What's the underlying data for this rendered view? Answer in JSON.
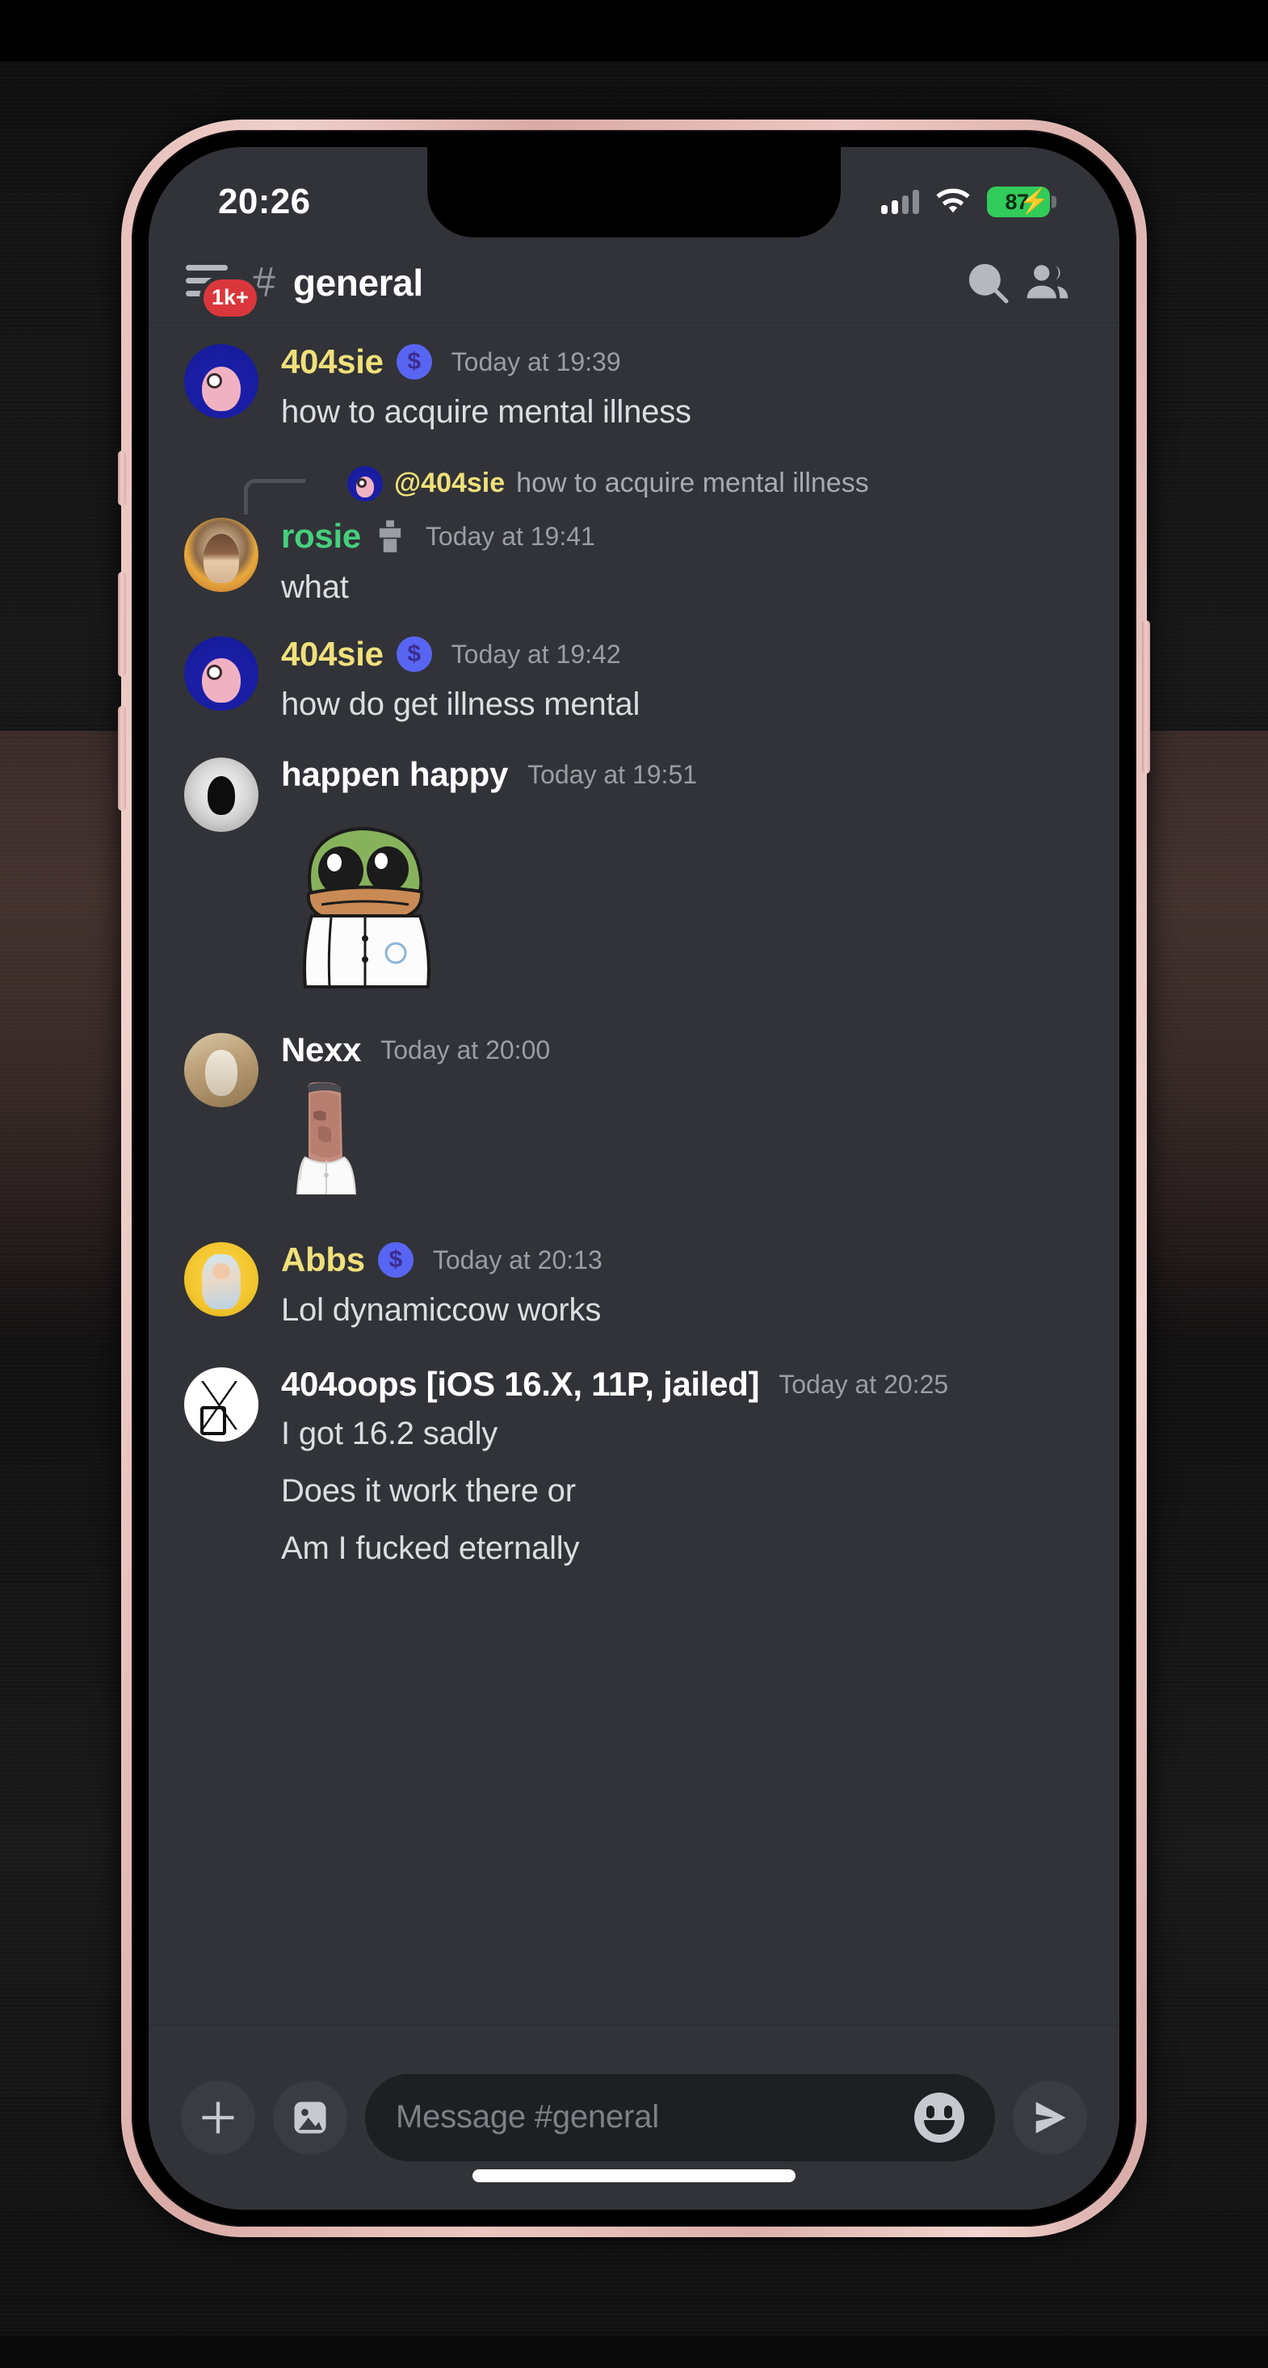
{
  "device": {
    "frame_color": "#e3b6b1",
    "screen_bg": "#313338"
  },
  "status_bar": {
    "time": "20:26",
    "signal_icon": "cellular-bars-icon",
    "signal_bars_filled": 2,
    "signal_bars_total": 4,
    "wifi_icon": "wifi-icon",
    "battery_percent": "87",
    "battery_charging": true,
    "battery_color": "#31cb5a"
  },
  "header": {
    "menu_icon": "hamburger-menu-icon",
    "unread_badge": "1k+",
    "badge_color": "#da373c",
    "hash_icon": "#",
    "channel_name": "general",
    "search_icon": "search-icon",
    "members_icon": "members-icon"
  },
  "messages": [
    {
      "id": "m1",
      "author": "404sie",
      "author_color": "yellow",
      "badge": "server-boost-badge",
      "timestamp": "Today at 19:39",
      "avatar": "slowpoke-avatar",
      "lines": [
        "how to acquire mental illness"
      ]
    },
    {
      "id": "m2",
      "type": "reply",
      "reply_to_author": "@404sie",
      "reply_to_text": "how to acquire mental illness",
      "reply_avatar": "slowpoke-avatar",
      "author": "rosie",
      "author_color": "green",
      "badge": "bot-tag-badge",
      "timestamp": "Today at 19:41",
      "avatar": "rosie-avatar",
      "lines": [
        "what"
      ]
    },
    {
      "id": "m3",
      "author": "404sie",
      "author_color": "yellow",
      "badge": "server-boost-badge",
      "timestamp": "Today at 19:42",
      "avatar": "slowpoke-avatar",
      "lines": [
        "how do get illness mental"
      ]
    },
    {
      "id": "m4",
      "author": "happen happy",
      "author_color": "white",
      "badge": null,
      "timestamp": "Today at 19:51",
      "avatar": "dark-blob-avatar",
      "lines": [],
      "attachment": "pepe-lab-coat-sticker"
    },
    {
      "id": "m5",
      "author": "Nexx",
      "author_color": "white",
      "badge": null,
      "timestamp": "Today at 20:00",
      "avatar": "cat-photo-avatar",
      "lines": [],
      "attachment": "moai-statue-sticker"
    },
    {
      "id": "m6",
      "author": "Abbs",
      "author_color": "yellow",
      "badge": "server-boost-badge",
      "timestamp": "Today at 20:13",
      "avatar": "anime-girl-yellow-avatar",
      "lines": [
        "Lol dynamiccow works"
      ]
    },
    {
      "id": "m7",
      "author": "404oops [iOS 16.X, 11P, jailed]",
      "author_color": "white",
      "badge": null,
      "timestamp": "Today at 20:25",
      "avatar": "lineart-avatar",
      "lines": [
        "I got 16.2 sadly",
        "Does it work there or",
        "Am I fucked eternally"
      ]
    }
  ],
  "input_bar": {
    "plus_icon": "plus-icon",
    "image_icon": "image-icon",
    "placeholder": "Message #general",
    "emoji_icon": "emoji-smiley-icon",
    "send_icon": "send-icon"
  },
  "colors": {
    "name_yellow": "#f0e07a",
    "name_green": "#46cf7c",
    "name_white": "#ffffff",
    "boost_badge": "#5865f2",
    "text": "#dbdee1",
    "muted": "#9a9ea4"
  }
}
